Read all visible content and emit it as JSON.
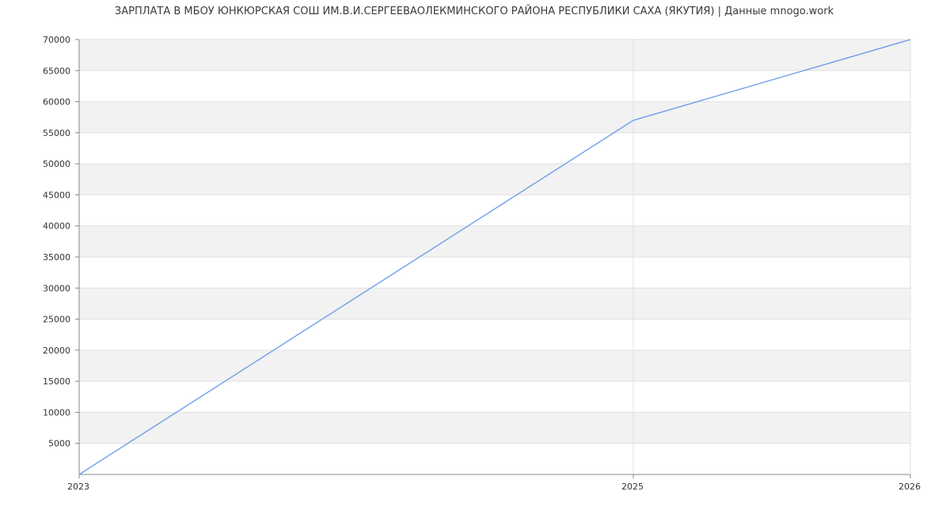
{
  "chart_data": {
    "type": "line",
    "title": "ЗАРПЛАТА В МБОУ ЮНКЮРСКАЯ СОШ ИМ.В.И.СЕРГЕЕВАОЛЕКМИНСКОГО РАЙОНА РЕСПУБЛИКИ САХА (ЯКУТИЯ) | Данные mnogo.work",
    "xlabel": "",
    "ylabel": "",
    "x": [
      2023,
      2025,
      2026
    ],
    "x_tick_labels": [
      "2023",
      "2025",
      "2026"
    ],
    "series": [
      {
        "values": [
          0,
          57000,
          70000
        ],
        "color": "#6d9eeb"
      }
    ],
    "ylim": [
      0,
      70000
    ],
    "y_ticks": [
      5000,
      10000,
      15000,
      20000,
      25000,
      30000,
      35000,
      40000,
      45000,
      50000,
      55000,
      60000,
      65000,
      70000
    ],
    "y_tick_labels": [
      "5000",
      "10000",
      "15000",
      "20000",
      "25000",
      "30000",
      "35000",
      "40000",
      "45000",
      "50000",
      "55000",
      "60000",
      "65000",
      "70000"
    ],
    "grid": true,
    "band_color": "#f2f2f2",
    "grid_color": "#e0e0e0",
    "axis_color": "#888888"
  }
}
